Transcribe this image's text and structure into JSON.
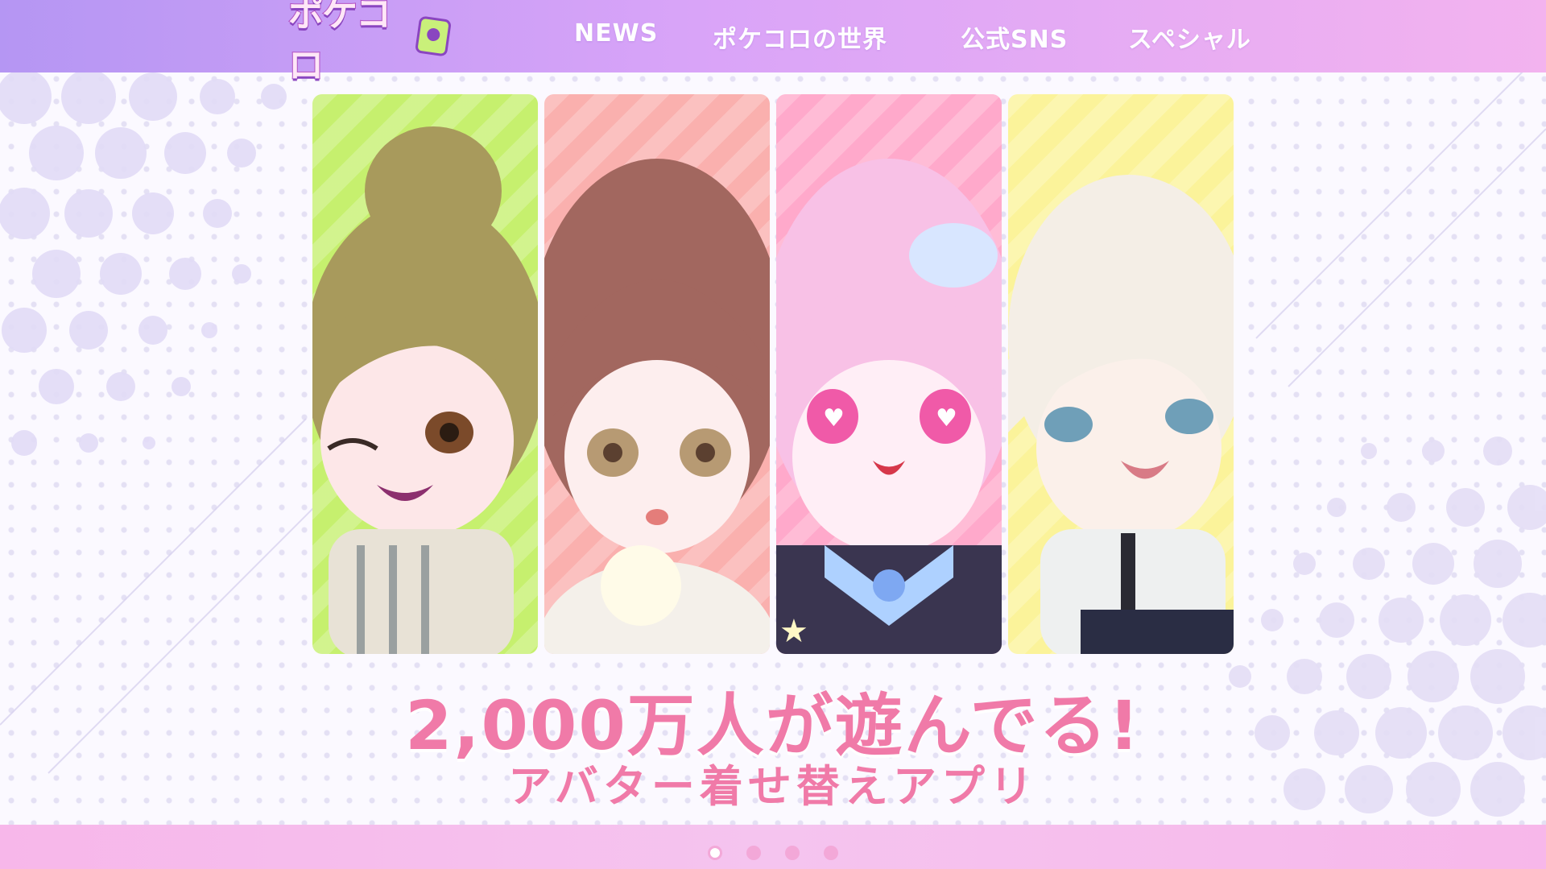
{
  "header": {
    "logo_text": "ポケコロ",
    "nav": [
      {
        "label": "NEWS"
      },
      {
        "label": "ポケコロの世界"
      },
      {
        "label": "公式SNS"
      },
      {
        "label": "スペシャル"
      }
    ]
  },
  "hero": {
    "cards": [
      {
        "bg": "#c6f06e",
        "hair": "#a89a5c",
        "eye": "#7b4a2a",
        "outfit": "#e8e2d6"
      },
      {
        "bg": "#fab0ae",
        "hair": "#a2675f",
        "eye": "#b79a73",
        "outfit": "#f4f0ea"
      },
      {
        "bg": "#ffa9cb",
        "hair": "#f8c1e6",
        "eye": "#f05aa8",
        "outfit": "#3a3550"
      },
      {
        "bg": "#fbf39a",
        "hair": "#f4eee6",
        "eye": "#6f9fb8",
        "outfit": "#eef0f0"
      }
    ],
    "headline": "2,000万人が遊んでる!",
    "subline": "アバター着せ替えアプリ"
  },
  "carousel": {
    "slides": 4,
    "active_index": 0
  },
  "colors": {
    "header_start": "#b596f3",
    "header_end": "#f3b3ef",
    "accent_pink": "#f07aa8",
    "dot_pink": "#f3a8d8"
  }
}
